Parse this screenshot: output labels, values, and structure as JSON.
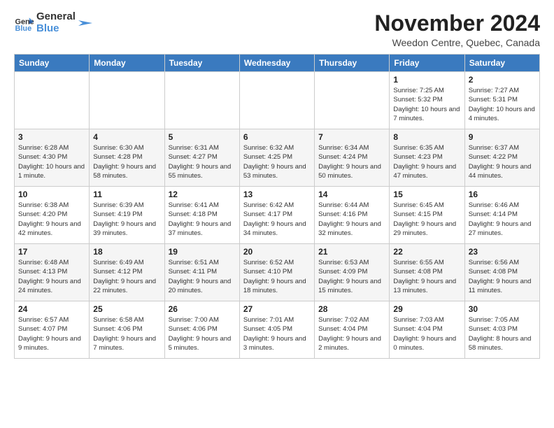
{
  "logo": {
    "line1": "General",
    "line2": "Blue"
  },
  "title": "November 2024",
  "subtitle": "Weedon Centre, Quebec, Canada",
  "headers": [
    "Sunday",
    "Monday",
    "Tuesday",
    "Wednesday",
    "Thursday",
    "Friday",
    "Saturday"
  ],
  "weeks": [
    [
      {
        "day": "",
        "info": ""
      },
      {
        "day": "",
        "info": ""
      },
      {
        "day": "",
        "info": ""
      },
      {
        "day": "",
        "info": ""
      },
      {
        "day": "",
        "info": ""
      },
      {
        "day": "1",
        "info": "Sunrise: 7:25 AM\nSunset: 5:32 PM\nDaylight: 10 hours and 7 minutes."
      },
      {
        "day": "2",
        "info": "Sunrise: 7:27 AM\nSunset: 5:31 PM\nDaylight: 10 hours and 4 minutes."
      }
    ],
    [
      {
        "day": "3",
        "info": "Sunrise: 6:28 AM\nSunset: 4:30 PM\nDaylight: 10 hours and 1 minute."
      },
      {
        "day": "4",
        "info": "Sunrise: 6:30 AM\nSunset: 4:28 PM\nDaylight: 9 hours and 58 minutes."
      },
      {
        "day": "5",
        "info": "Sunrise: 6:31 AM\nSunset: 4:27 PM\nDaylight: 9 hours and 55 minutes."
      },
      {
        "day": "6",
        "info": "Sunrise: 6:32 AM\nSunset: 4:25 PM\nDaylight: 9 hours and 53 minutes."
      },
      {
        "day": "7",
        "info": "Sunrise: 6:34 AM\nSunset: 4:24 PM\nDaylight: 9 hours and 50 minutes."
      },
      {
        "day": "8",
        "info": "Sunrise: 6:35 AM\nSunset: 4:23 PM\nDaylight: 9 hours and 47 minutes."
      },
      {
        "day": "9",
        "info": "Sunrise: 6:37 AM\nSunset: 4:22 PM\nDaylight: 9 hours and 44 minutes."
      }
    ],
    [
      {
        "day": "10",
        "info": "Sunrise: 6:38 AM\nSunset: 4:20 PM\nDaylight: 9 hours and 42 minutes."
      },
      {
        "day": "11",
        "info": "Sunrise: 6:39 AM\nSunset: 4:19 PM\nDaylight: 9 hours and 39 minutes."
      },
      {
        "day": "12",
        "info": "Sunrise: 6:41 AM\nSunset: 4:18 PM\nDaylight: 9 hours and 37 minutes."
      },
      {
        "day": "13",
        "info": "Sunrise: 6:42 AM\nSunset: 4:17 PM\nDaylight: 9 hours and 34 minutes."
      },
      {
        "day": "14",
        "info": "Sunrise: 6:44 AM\nSunset: 4:16 PM\nDaylight: 9 hours and 32 minutes."
      },
      {
        "day": "15",
        "info": "Sunrise: 6:45 AM\nSunset: 4:15 PM\nDaylight: 9 hours and 29 minutes."
      },
      {
        "day": "16",
        "info": "Sunrise: 6:46 AM\nSunset: 4:14 PM\nDaylight: 9 hours and 27 minutes."
      }
    ],
    [
      {
        "day": "17",
        "info": "Sunrise: 6:48 AM\nSunset: 4:13 PM\nDaylight: 9 hours and 24 minutes."
      },
      {
        "day": "18",
        "info": "Sunrise: 6:49 AM\nSunset: 4:12 PM\nDaylight: 9 hours and 22 minutes."
      },
      {
        "day": "19",
        "info": "Sunrise: 6:51 AM\nSunset: 4:11 PM\nDaylight: 9 hours and 20 minutes."
      },
      {
        "day": "20",
        "info": "Sunrise: 6:52 AM\nSunset: 4:10 PM\nDaylight: 9 hours and 18 minutes."
      },
      {
        "day": "21",
        "info": "Sunrise: 6:53 AM\nSunset: 4:09 PM\nDaylight: 9 hours and 15 minutes."
      },
      {
        "day": "22",
        "info": "Sunrise: 6:55 AM\nSunset: 4:08 PM\nDaylight: 9 hours and 13 minutes."
      },
      {
        "day": "23",
        "info": "Sunrise: 6:56 AM\nSunset: 4:08 PM\nDaylight: 9 hours and 11 minutes."
      }
    ],
    [
      {
        "day": "24",
        "info": "Sunrise: 6:57 AM\nSunset: 4:07 PM\nDaylight: 9 hours and 9 minutes."
      },
      {
        "day": "25",
        "info": "Sunrise: 6:58 AM\nSunset: 4:06 PM\nDaylight: 9 hours and 7 minutes."
      },
      {
        "day": "26",
        "info": "Sunrise: 7:00 AM\nSunset: 4:06 PM\nDaylight: 9 hours and 5 minutes."
      },
      {
        "day": "27",
        "info": "Sunrise: 7:01 AM\nSunset: 4:05 PM\nDaylight: 9 hours and 3 minutes."
      },
      {
        "day": "28",
        "info": "Sunrise: 7:02 AM\nSunset: 4:04 PM\nDaylight: 9 hours and 2 minutes."
      },
      {
        "day": "29",
        "info": "Sunrise: 7:03 AM\nSunset: 4:04 PM\nDaylight: 9 hours and 0 minutes."
      },
      {
        "day": "30",
        "info": "Sunrise: 7:05 AM\nSunset: 4:03 PM\nDaylight: 8 hours and 58 minutes."
      }
    ]
  ]
}
